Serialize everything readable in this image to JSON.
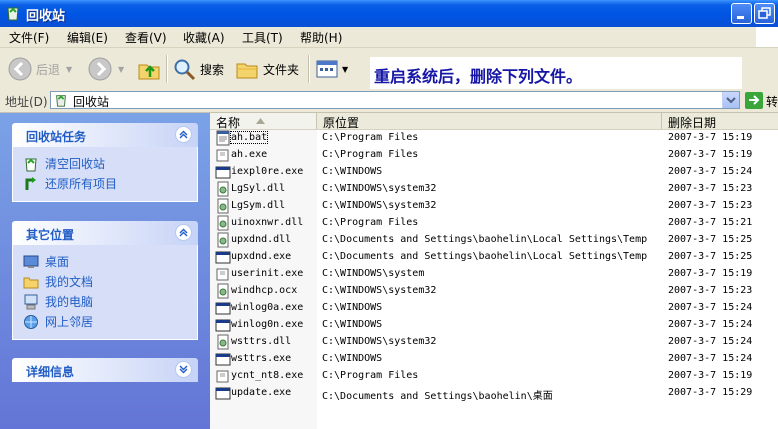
{
  "window": {
    "title": "回收站",
    "accent": "#0054e3"
  },
  "menu": [
    "文件(F)",
    "编辑(E)",
    "查看(V)",
    "收藏(A)",
    "工具(T)",
    "帮助(H)"
  ],
  "toolbar": {
    "back_label": "后退",
    "search_label": "搜索",
    "folders_label": "文件夹"
  },
  "notice": "重启系统后，删除下列文件。",
  "address": {
    "label": "地址(D)",
    "value": "回收站",
    "go_label": "转"
  },
  "sidebar": {
    "recycle_tasks": {
      "title": "回收站任务",
      "items": [
        "清空回收站",
        "还原所有项目"
      ]
    },
    "other_places": {
      "title": "其它位置",
      "items": [
        "桌面",
        "我的文档",
        "我的电脑",
        "网上邻居"
      ]
    },
    "details": {
      "title": "详细信息"
    }
  },
  "columns": {
    "name": "名称",
    "location": "原位置",
    "date": "删除日期"
  },
  "files": [
    {
      "name": "ah.bat",
      "location": "C:\\Program Files",
      "date": "2007-3-7 15:19",
      "icon": "batch-icon"
    },
    {
      "name": "ah.exe",
      "location": "C:\\Program Files",
      "date": "2007-3-7 15:19",
      "icon": "program-icon"
    },
    {
      "name": "iexpl0re.exe",
      "location": "C:\\WINDOWS",
      "date": "2007-3-7 15:24",
      "icon": "window-exe-icon"
    },
    {
      "name": "LgSyl.dll",
      "location": "C:\\WINDOWS\\system32",
      "date": "2007-3-7 15:23",
      "icon": "dll-icon"
    },
    {
      "name": "LgSym.dll",
      "location": "C:\\WINDOWS\\system32",
      "date": "2007-3-7 15:23",
      "icon": "dll-icon"
    },
    {
      "name": "uinoxnwr.dll",
      "location": "C:\\Program Files",
      "date": "2007-3-7 15:21",
      "icon": "dll-icon"
    },
    {
      "name": "upxdnd.dll",
      "location": "C:\\Documents and Settings\\baohelin\\Local Settings\\Temp",
      "date": "2007-3-7 15:25",
      "icon": "dll-icon"
    },
    {
      "name": "upxdnd.exe",
      "location": "C:\\Documents and Settings\\baohelin\\Local Settings\\Temp",
      "date": "2007-3-7 15:25",
      "icon": "window-exe-icon"
    },
    {
      "name": "userinit.exe",
      "location": "C:\\WINDOWS\\system",
      "date": "2007-3-7 15:19",
      "icon": "program-icon"
    },
    {
      "name": "windhcp.ocx",
      "location": "C:\\WINDOWS\\system32",
      "date": "2007-3-7 15:23",
      "icon": "dll-icon"
    },
    {
      "name": "winlog0a.exe",
      "location": "C:\\WINDOWS",
      "date": "2007-3-7 15:24",
      "icon": "window-exe-icon"
    },
    {
      "name": "winlog0n.exe",
      "location": "C:\\WINDOWS",
      "date": "2007-3-7 15:24",
      "icon": "window-exe-icon"
    },
    {
      "name": "wsttrs.dll",
      "location": "C:\\WINDOWS\\system32",
      "date": "2007-3-7 15:24",
      "icon": "dll-icon"
    },
    {
      "name": "wsttrs.exe",
      "location": "C:\\WINDOWS",
      "date": "2007-3-7 15:24",
      "icon": "window-exe-icon"
    },
    {
      "name": "ycnt_nt8.exe",
      "location": "C:\\Program Files",
      "date": "2007-3-7 15:19",
      "icon": "program-icon"
    },
    {
      "name": "update.exe",
      "location": "C:\\Documents and Settings\\baohelin\\桌面",
      "date": "2007-3-7 15:29",
      "icon": "window-exe-icon"
    }
  ]
}
